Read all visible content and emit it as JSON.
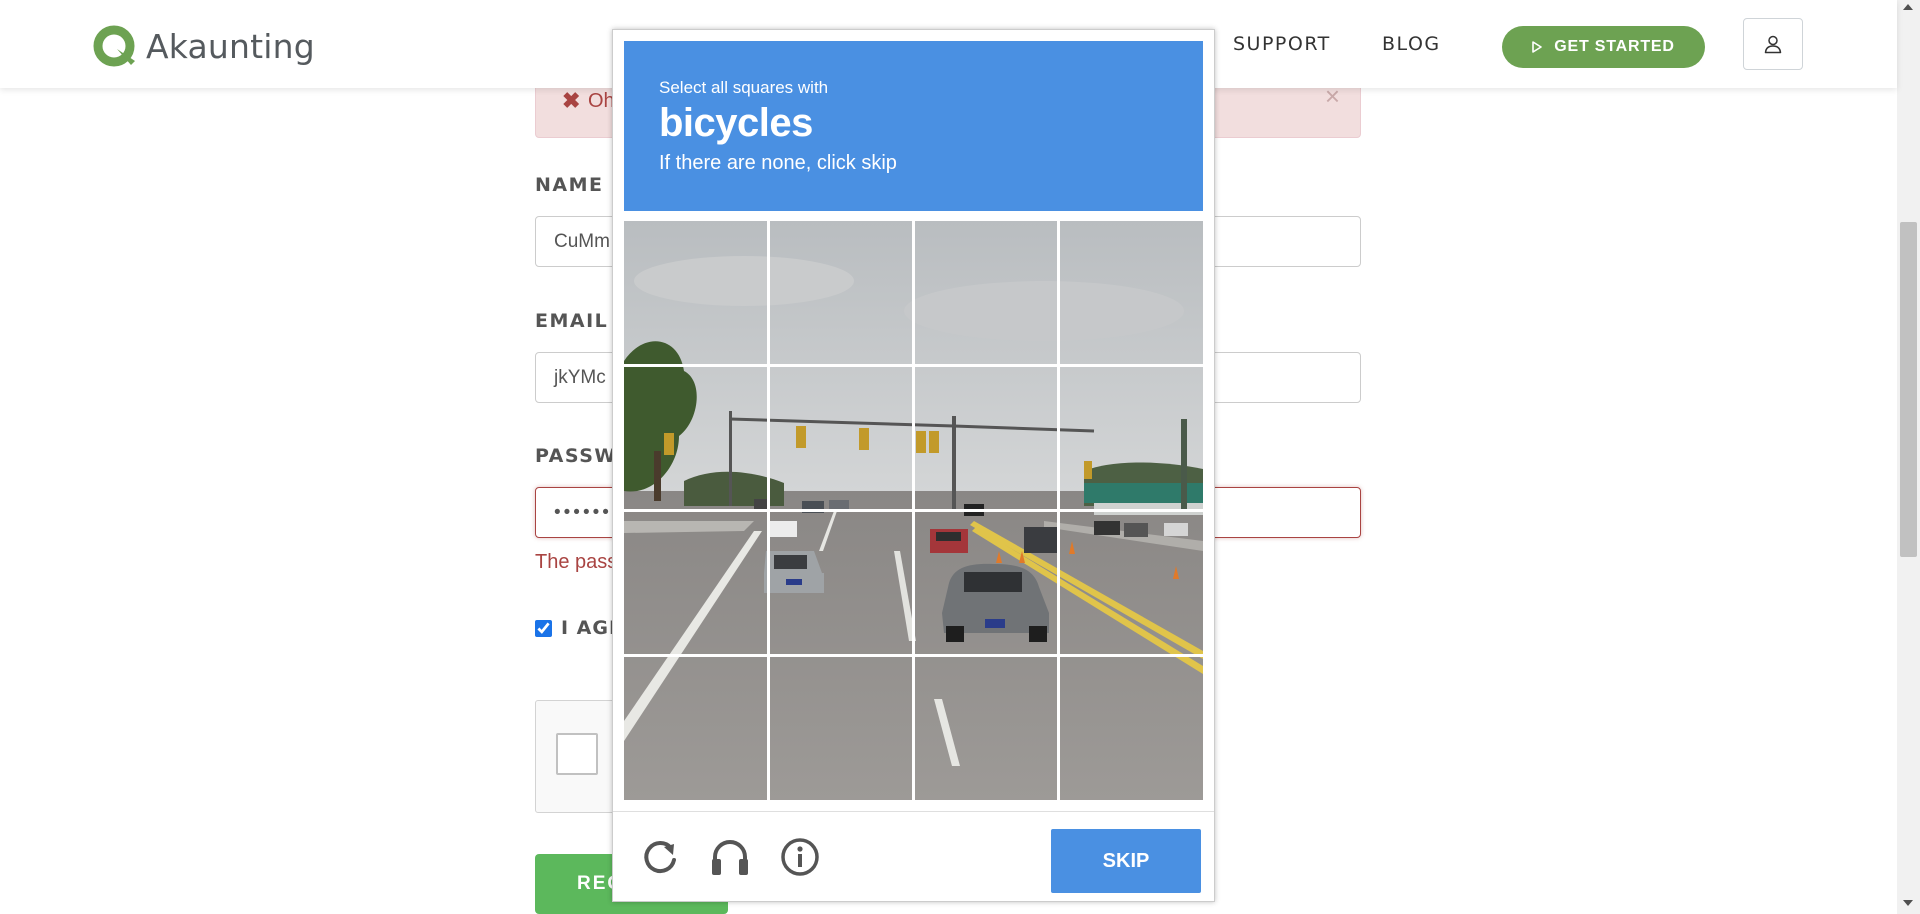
{
  "header": {
    "logo_text": "Akaunting",
    "nav": [
      {
        "label": "SUPPORT"
      },
      {
        "label": "BLOG"
      }
    ],
    "cta_label": "GET STARTED",
    "colors": {
      "brand_green": "#6da252"
    }
  },
  "form": {
    "alert_text": "Oh",
    "name_label": "NAME",
    "name_value": "CuMm",
    "email_label": "EMAIL",
    "email_value": "jkYMc",
    "password_label": "PASSWO",
    "password_value": "••••••",
    "password_error": "The pass",
    "agree_label": "I AGR",
    "agree_checked": true,
    "register_label": "REG"
  },
  "captcha": {
    "instruction": "Select all squares with",
    "target": "bicycles",
    "hint": "If there are none, click skip",
    "grid_size": 4,
    "skip_label": "SKIP",
    "icons": [
      "reload-icon",
      "audio-headphones-icon",
      "info-icon"
    ],
    "colors": {
      "accent": "#4a90e2"
    }
  }
}
